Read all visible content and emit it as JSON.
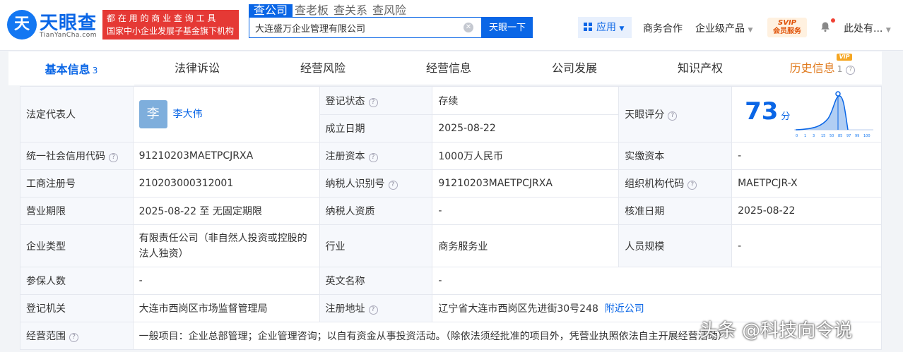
{
  "header": {
    "logo_mark": "天",
    "logo_text": "天眼查",
    "logo_sub": "TianYanCha.com",
    "slogan_line1": "都 在 用 的 商 业 查 询 工 具",
    "slogan_line2": "国家中小企业发展子基金旗下机构",
    "search_tabs": [
      "查公司",
      "查老板",
      "查关系",
      "查风险"
    ],
    "search_value": "大连盛万企业管理有限公司",
    "search_button": "天眼一下",
    "app_menu": "应用",
    "nav_items": [
      "商务合作",
      "企业级产品"
    ],
    "vip_line1": "SVIP",
    "vip_line2": "会员服务",
    "user": "此处有..."
  },
  "tabs": [
    {
      "label": "基本信息",
      "count": "3"
    },
    {
      "label": "法律诉讼"
    },
    {
      "label": "经营风险"
    },
    {
      "label": "经营信息"
    },
    {
      "label": "公司发展"
    },
    {
      "label": "知识产权"
    },
    {
      "label": "历史信息",
      "count": "1"
    }
  ],
  "vip_tag": "VIP",
  "info": {
    "legal_rep_label": "法定代表人",
    "legal_rep_avatar": "李",
    "legal_rep_name": "李大伟",
    "status_label": "登记状态",
    "status_value": "存续",
    "established_label": "成立日期",
    "established_value": "2025-08-22",
    "score_label": "天眼评分",
    "score_value": "73",
    "score_unit": "分",
    "score_axis": [
      "0",
      "1",
      "3",
      "15",
      "50",
      "85",
      "97",
      "99",
      "100"
    ],
    "credit_code_label": "统一社会信用代码",
    "credit_code_value": "91210203MAETPCJRXA",
    "reg_capital_label": "注册资本",
    "reg_capital_value": "1000万人民币",
    "paid_capital_label": "实缴资本",
    "paid_capital_value": "-",
    "reg_no_label": "工商注册号",
    "reg_no_value": "210203000312001",
    "tax_id_label": "纳税人识别号",
    "tax_id_value": "91210203MAETPCJRXA",
    "org_code_label": "组织机构代码",
    "org_code_value": "MAETPCJR-X",
    "term_label": "营业期限",
    "term_value": "2025-08-22 至 无固定期限",
    "tax_qual_label": "纳税人资质",
    "tax_qual_value": "-",
    "approval_label": "核准日期",
    "approval_value": "2025-08-22",
    "type_label": "企业类型",
    "type_value_1": "有限责任公司（非自然人投资或控股的",
    "type_value_2": "法人独资）",
    "industry_label": "行业",
    "industry_value": "商务服务业",
    "staff_label": "人员规模",
    "staff_value": "-",
    "insured_label": "参保人数",
    "insured_value": "-",
    "english_label": "英文名称",
    "english_value": "-",
    "authority_label": "登记机关",
    "authority_value": "大连市西岗区市场监督管理局",
    "address_label": "注册地址",
    "address_value": "辽宁省大连市西岗区先进街30号248",
    "nearby_link": "附近公司",
    "scope_label": "经营范围",
    "scope_value": "一般项目：企业总部管理；企业管理咨询；以自有资金从事投资活动。（除依法须经批准的项目外，凭营业执照依法自主开展经营活动）"
  },
  "watermark": "头条 @科技向令说"
}
